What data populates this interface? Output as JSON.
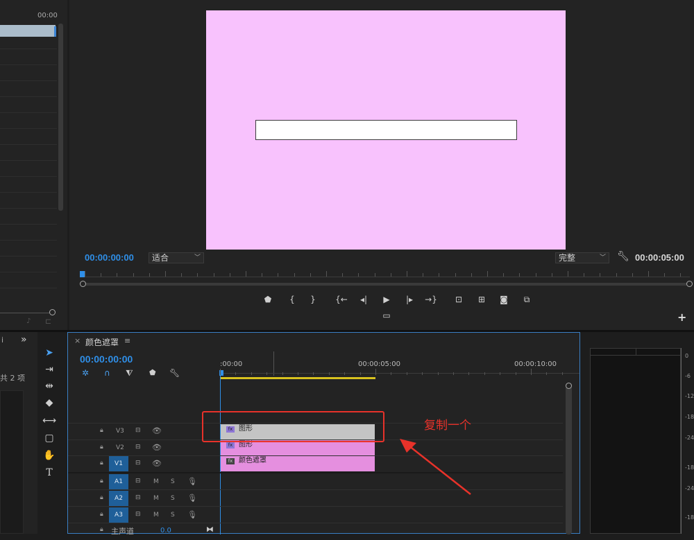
{
  "project": {
    "timecode": "00:00",
    "item_count": "共 2 项",
    "tab_fragment": "i",
    "overflow": "»"
  },
  "monitor": {
    "timecode_current": "00:00:00:00",
    "zoom_value": "适合",
    "quality_value": "完整",
    "timecode_duration": "00:00:05:00",
    "video_bg": "#f8c2fd"
  },
  "timeline": {
    "close_icon": "×",
    "sequence_name": "颜色遮罩",
    "menu_icon": "≡",
    "timecode": "00:00:00:00",
    "ruler_labels": [
      ":00:00",
      "00:00:05:00",
      "00:00:10:00"
    ],
    "tracks_video": [
      {
        "name": "V3"
      },
      {
        "name": "V2"
      },
      {
        "name": "V1"
      }
    ],
    "tracks_audio": [
      {
        "name": "A1",
        "m": "M",
        "s": "S"
      },
      {
        "name": "A2",
        "m": "M",
        "s": "S"
      },
      {
        "name": "A3",
        "m": "M",
        "s": "S"
      }
    ],
    "master": {
      "label": "主声道",
      "value": "0.0"
    },
    "clips": [
      {
        "label": "图形",
        "track": "V3",
        "fx": "fx"
      },
      {
        "label": "图形",
        "track": "V2",
        "fx": "fx"
      },
      {
        "label": "颜色遮罩",
        "track": "V1",
        "fx": "fx"
      }
    ]
  },
  "annotation": {
    "text": "复制一个",
    "color": "#e8322a"
  },
  "meter": {
    "db_labels": [
      "0",
      "-6",
      "-12",
      "-18",
      "-24",
      "-18",
      "-24",
      "-18"
    ]
  },
  "colors": {
    "accent": "#2f8fe8",
    "track_selected": "#1f5f99",
    "clip_gray": "#c4c4c4",
    "clip_pink": "#e58fdf",
    "work_area": "#d8c21e"
  }
}
